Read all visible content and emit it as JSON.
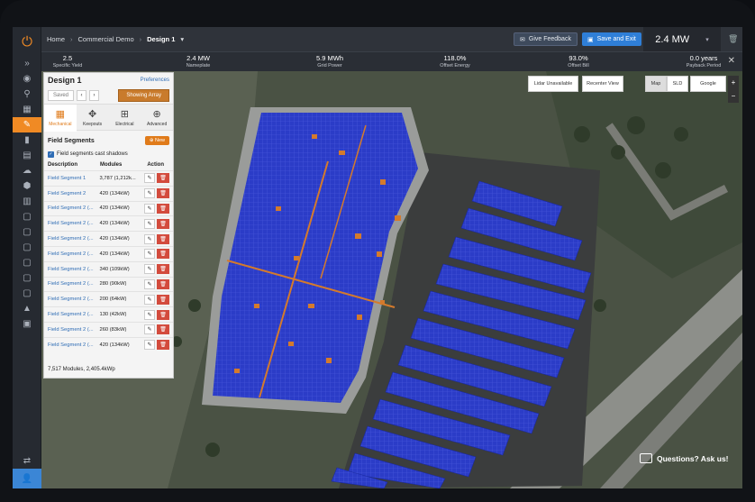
{
  "rail": {
    "items": [
      "»",
      "◉",
      "⚲",
      "▦",
      "✎",
      "▮",
      "▤",
      "☁",
      "⬢",
      "▥",
      "▢",
      "▢",
      "▢",
      "▢",
      "▢",
      "▢",
      "▲",
      "▣"
    ],
    "bottom": [
      "⇄",
      "👤"
    ]
  },
  "topbar": {
    "crumbs": [
      "Home",
      "Commercial Demo",
      "Design 1"
    ],
    "dropdown": "▾",
    "feedback": "Give Feedback",
    "save": "Save and Exit",
    "power": "2.4 MW",
    "power_caret": "▾"
  },
  "stats": [
    {
      "value": "2.5",
      "label": "Specific Yield"
    },
    {
      "value": "2.4 MW",
      "label": "Nameplate"
    },
    {
      "value": "5.9 MWh",
      "label": "Grid Power"
    },
    {
      "value": "118.0%",
      "label": "Offset Energy"
    },
    {
      "value": "93.0%",
      "label": "Offset Bill"
    },
    {
      "value": "0.0 years",
      "label": "Payback Period"
    }
  ],
  "map": {
    "lidar": "Lidar Unavailable",
    "recenter": "Recenter View",
    "map_btn": "Map",
    "sld_btn": "SLD",
    "google_btn": "Google",
    "ask": "Questions? Ask us!"
  },
  "panel": {
    "title": "Design 1",
    "preferences": "Preferences",
    "saved": "Saved",
    "prev": "‹",
    "next": "›",
    "showing": "Showing Array",
    "tools": [
      {
        "label": "Mechanical",
        "icon": "▦"
      },
      {
        "label": "Keepouts",
        "icon": "✥"
      },
      {
        "label": "Electrical",
        "icon": "⊞"
      },
      {
        "label": "Advanced",
        "icon": "⊕"
      }
    ],
    "field_segments": "Field Segments",
    "new": "New",
    "cast": "Field segments cast shadows",
    "col_desc": "Description",
    "col_mods": "Modules",
    "col_action": "Action",
    "rows": [
      {
        "desc": "Field Segment 1",
        "mods": "3,787 (1,212k..."
      },
      {
        "desc": "Field Segment 2",
        "mods": "420 (134kW)"
      },
      {
        "desc": "Field Segment 2 (...",
        "mods": "420 (134kW)"
      },
      {
        "desc": "Field Segment 2 (...",
        "mods": "420 (134kW)"
      },
      {
        "desc": "Field Segment 2 (...",
        "mods": "420 (134kW)"
      },
      {
        "desc": "Field Segment 2 (...",
        "mods": "420 (134kW)"
      },
      {
        "desc": "Field Segment 2 (...",
        "mods": "340 (109kW)"
      },
      {
        "desc": "Field Segment 2 (...",
        "mods": "280 (90kW)"
      },
      {
        "desc": "Field Segment 2 (...",
        "mods": "200 (64kW)"
      },
      {
        "desc": "Field Segment 2 (...",
        "mods": "130 (42kW)"
      },
      {
        "desc": "Field Segment 2 (...",
        "mods": "260 (83kW)"
      },
      {
        "desc": "Field Segment 2 (...",
        "mods": "420 (134kW)"
      }
    ],
    "total": "7,517 Modules, 2,405.4kWp"
  }
}
